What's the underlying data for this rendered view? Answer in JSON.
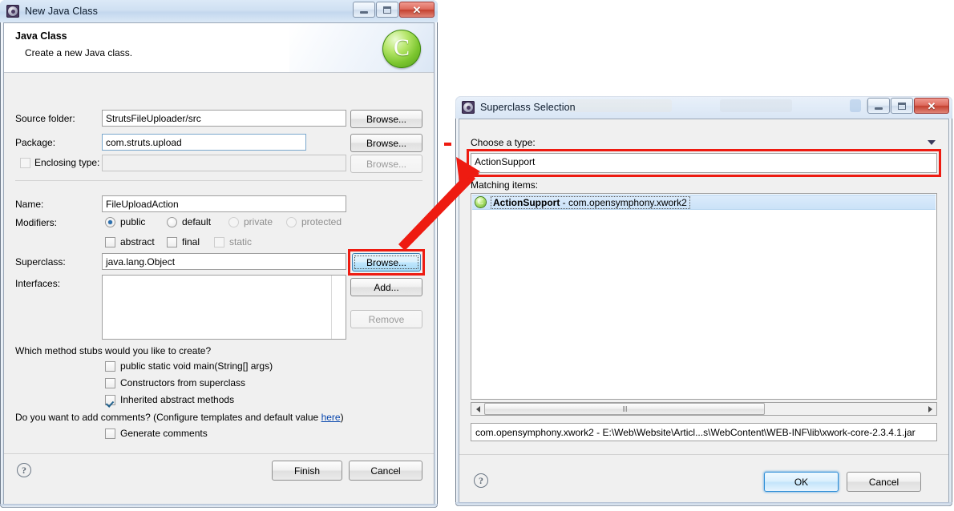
{
  "new_java_class_dialog": {
    "title": "New Java Class",
    "icon": "eclipse-wizard-icon",
    "caption_buttons": {
      "minimize": "–",
      "maximize": "□",
      "close": "✕"
    },
    "header": {
      "title": "Java Class",
      "subtitle": "Create a new Java class.",
      "banner_icon_letter": "C"
    },
    "fields": {
      "source_folder": {
        "label": "Source folder:",
        "value": "StrutsFileUploader/src",
        "browse": "Browse..."
      },
      "package": {
        "label": "Package:",
        "value": "com.struts.upload",
        "browse": "Browse..."
      },
      "enclosing_type": {
        "label": "Enclosing type:",
        "value": "",
        "checked": false,
        "browse": "Browse..."
      },
      "name": {
        "label": "Name:",
        "value": "FileUploadAction"
      },
      "superclass": {
        "label": "Superclass:",
        "value": "java.lang.Object",
        "browse": "Browse..."
      },
      "interfaces": {
        "label": "Interfaces:",
        "add": "Add...",
        "remove": "Remove",
        "items": []
      }
    },
    "modifiers": {
      "label": "Modifiers:",
      "access": [
        {
          "label": "public",
          "selected": true,
          "enabled": true
        },
        {
          "label": "default",
          "selected": false,
          "enabled": true
        },
        {
          "label": "private",
          "selected": false,
          "enabled": false
        },
        {
          "label": "protected",
          "selected": false,
          "enabled": false
        }
      ],
      "flags": [
        {
          "label": "abstract",
          "checked": false,
          "enabled": true
        },
        {
          "label": "final",
          "checked": false,
          "enabled": true
        },
        {
          "label": "static",
          "checked": false,
          "enabled": false
        }
      ]
    },
    "stubs": {
      "question": "Which method stubs would you like to create?",
      "options": [
        {
          "label": "public static void main(String[] args)",
          "checked": false
        },
        {
          "label": "Constructors from superclass",
          "checked": false
        },
        {
          "label": "Inherited abstract methods",
          "checked": true
        }
      ]
    },
    "comments": {
      "question_prefix": "Do you want to add comments? (Configure templates and default value ",
      "link": "here",
      "question_suffix": ")",
      "option": {
        "label": "Generate comments",
        "checked": false
      }
    },
    "buttons": {
      "help": "?",
      "finish": "Finish",
      "cancel": "Cancel"
    }
  },
  "superclass_selection_dialog": {
    "title": "Superclass Selection",
    "icon": "eclipse-wizard-icon",
    "caption_buttons": {
      "minimize": "–",
      "maximize": "□",
      "close": "✕"
    },
    "choose_type": {
      "label": "Choose a type:",
      "value": "ActionSupport"
    },
    "matching_items": {
      "label": "Matching items:",
      "rows": [
        {
          "name": "ActionSupport",
          "package": "- com.opensymphony.xwork2",
          "icon": "java-class-icon",
          "selected": true
        }
      ]
    },
    "status_path": "com.opensymphony.xwork2 - E:\\Web\\Website\\Articl...s\\WebContent\\WEB-INF\\lib\\xwork-core-2.3.4.1.jar",
    "buttons": {
      "help": "?",
      "ok": "OK",
      "cancel": "Cancel"
    }
  },
  "annotations": {
    "highlight_color": "#ee1b11",
    "arrow_from": "superclass-browse-button",
    "arrow_to": "choose-a-type-input"
  }
}
